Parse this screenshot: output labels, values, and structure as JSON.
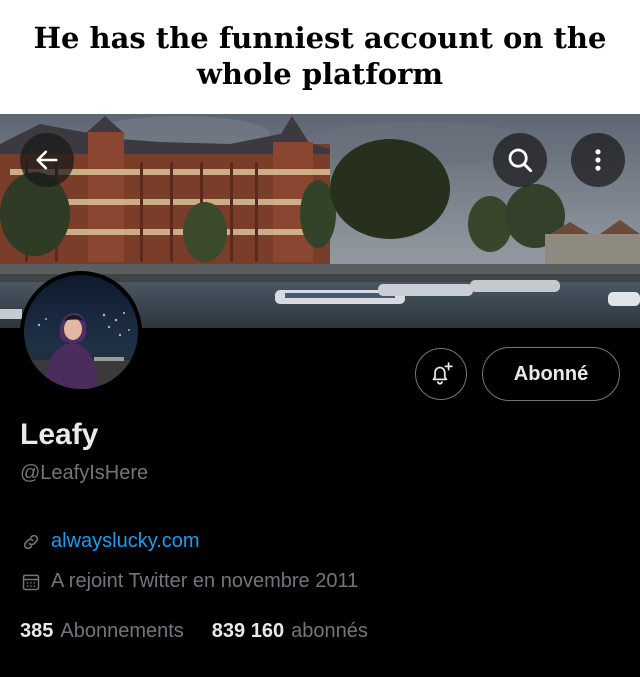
{
  "caption": {
    "line1": "He has the funniest account on the",
    "line2": "whole platform"
  },
  "header": {
    "back_icon": "arrow-left-icon",
    "search_icon": "search-icon",
    "more_icon": "more-vertical-icon"
  },
  "profile": {
    "name": "Leafy",
    "handle": "@LeafyIsHere",
    "website": "alwayslucky.com",
    "joined": "A rejoint Twitter en novembre 2011",
    "follow_label": "Abonné",
    "notify_icon": "bell-plus-icon",
    "link_icon": "link-icon",
    "calendar_icon": "calendar-icon"
  },
  "stats": {
    "following_count": "385",
    "following_label": "Abonnements",
    "followers_count": "839 160",
    "followers_label": "abonnés"
  },
  "colors": {
    "background": "#000000",
    "link": "#1d9bf0",
    "primary_text": "#e7e9ea",
    "secondary_text": "#71767b"
  }
}
